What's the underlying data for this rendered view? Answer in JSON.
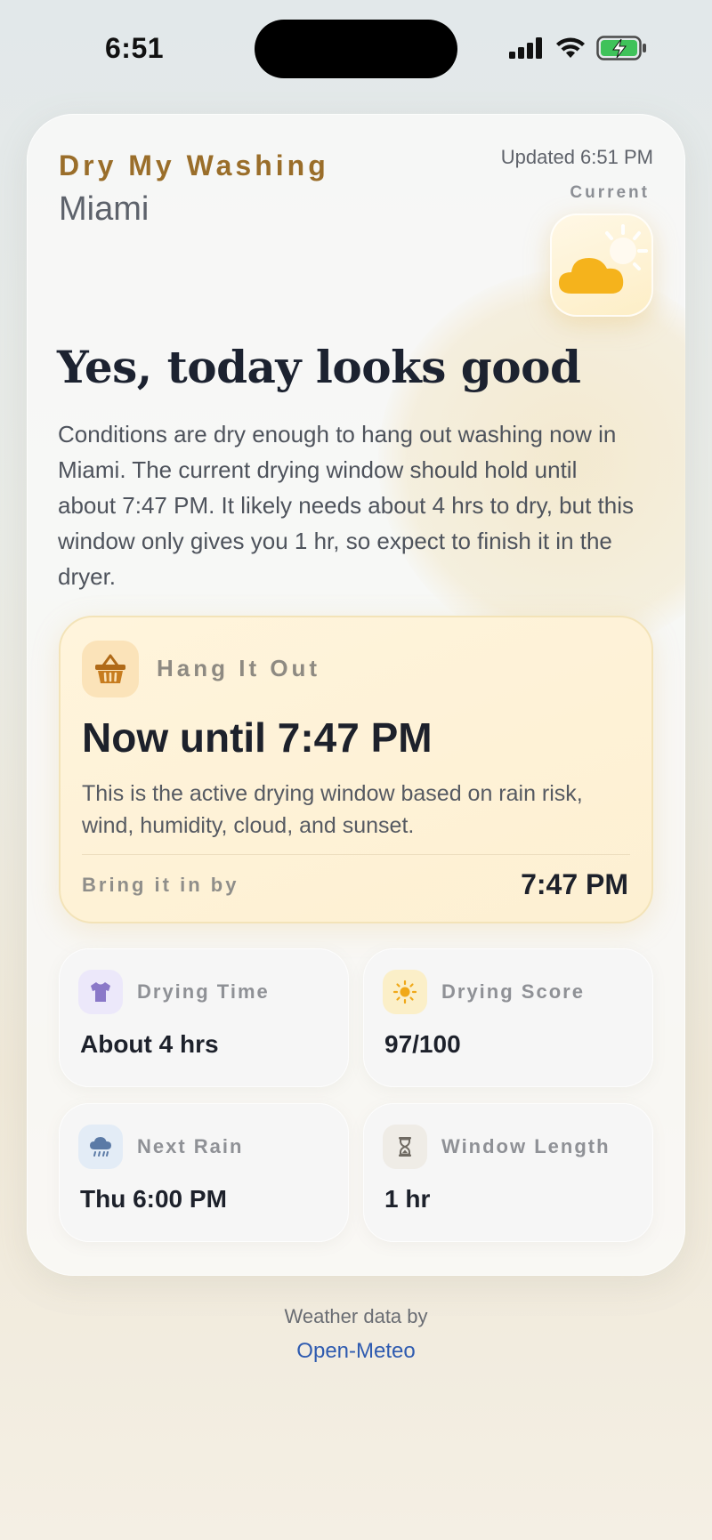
{
  "status_bar": {
    "time": "6:51",
    "icons": [
      "cellular-signal-icon",
      "wifi-icon",
      "battery-charging-icon"
    ]
  },
  "app": {
    "brand": "Dry My Washing",
    "city": "Miami",
    "updated": "Updated 6:51 PM",
    "current_label": "Current",
    "current_icon": "partly-cloudy-sun-icon"
  },
  "verdict": {
    "headline": "Yes, today looks good",
    "summary": "Conditions are dry enough to hang out washing now in Miami. The current drying window should hold until about 7:47 PM. It likely needs about 4 hrs to dry, but this window only gives you 1 hr, so expect to finish it in the dryer."
  },
  "hang_out": {
    "icon": "basket-icon",
    "title": "Hang It Out",
    "window": "Now until 7:47 PM",
    "description": "This is the active drying window based on rain risk, wind, humidity, cloud, and sunset.",
    "bring_in_label": "Bring it in by",
    "bring_in_time": "7:47 PM"
  },
  "stats": [
    {
      "icon": "tshirt-icon",
      "label": "Drying Time",
      "value": "About 4 hrs"
    },
    {
      "icon": "sun-icon",
      "label": "Drying Score",
      "value": "97/100"
    },
    {
      "icon": "rain-cloud-icon",
      "label": "Next Rain",
      "value": "Thu 6:00 PM"
    },
    {
      "icon": "hourglass-icon",
      "label": "Window Length",
      "value": "1 hr"
    }
  ],
  "footer": {
    "credit": "Weather data by",
    "link": "Open-Meteo"
  },
  "colors": {
    "brand": "#9a6e2a",
    "accent_sun": "#f5b31c",
    "link": "#2f5bb0",
    "panel": "#fff4dc"
  }
}
